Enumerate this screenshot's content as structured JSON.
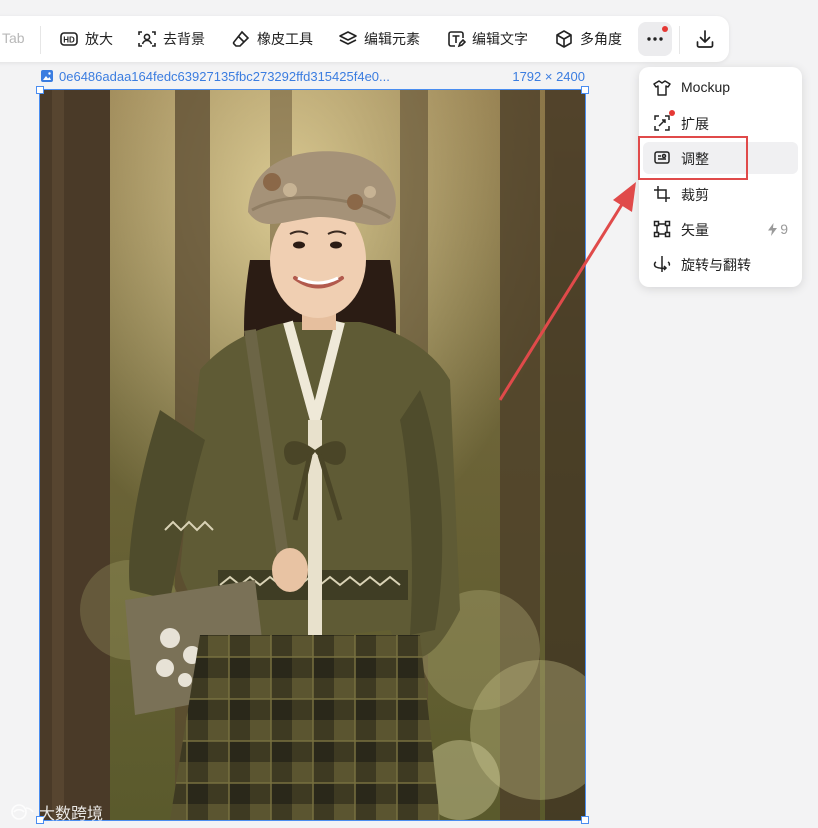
{
  "toolbar": {
    "faded_label": "Tab",
    "buttons": [
      {
        "label": "放大",
        "icon": "hd-icon"
      },
      {
        "label": "去背景",
        "icon": "person-scan-icon"
      },
      {
        "label": "橡皮工具",
        "icon": "eraser-icon"
      },
      {
        "label": "编辑元素",
        "icon": "layers-icon"
      },
      {
        "label": "编辑文字",
        "icon": "text-edit-icon"
      },
      {
        "label": "多角度",
        "icon": "cube-icon"
      }
    ],
    "more_icon": "more-dots-icon",
    "download_icon": "download-icon",
    "notification_color": "#e53935"
  },
  "file": {
    "name": "0e6486adaa164fedc63927135fbc273292ffd315425f4e0...",
    "dimensions": "1792 × 2400",
    "color": "#3b7de0"
  },
  "menu": {
    "items": [
      {
        "label": "Mockup",
        "icon": "tshirt-icon"
      },
      {
        "label": "扩展",
        "icon": "expand-icon",
        "badge": true
      },
      {
        "label": "调整",
        "icon": "adjust-icon",
        "active": true
      },
      {
        "label": "裁剪",
        "icon": "crop-icon"
      },
      {
        "label": "矢量",
        "icon": "vector-icon",
        "credit": "9"
      },
      {
        "label": "旋转与翻转",
        "icon": "rotate-flip-icon"
      }
    ]
  },
  "annotation": {
    "color": "#e04a4a",
    "target": "调整"
  },
  "canvas": {
    "selection_color": "#4a8df0"
  },
  "watermark": {
    "text": "大数跨境"
  }
}
